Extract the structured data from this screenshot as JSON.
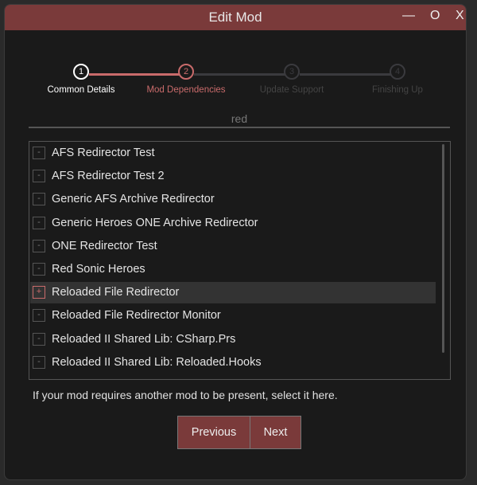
{
  "window": {
    "title": "Edit Mod",
    "minimize": "—",
    "maximize": "O",
    "close": "X"
  },
  "stepper": [
    {
      "num": "1",
      "label": "Common Details",
      "state": "done"
    },
    {
      "num": "2",
      "label": "Mod Dependencies",
      "state": "active"
    },
    {
      "num": "3",
      "label": "Update Support",
      "state": "pending"
    },
    {
      "num": "4",
      "label": "Finishing Up",
      "state": "pending"
    }
  ],
  "search": {
    "value": "red"
  },
  "list": [
    {
      "label": "AFS Redirector Test",
      "checked": false,
      "mark": "-"
    },
    {
      "label": "AFS Redirector Test 2",
      "checked": false,
      "mark": "-"
    },
    {
      "label": "Generic AFS Archive Redirector",
      "checked": false,
      "mark": "-"
    },
    {
      "label": "Generic Heroes ONE Archive Redirector",
      "checked": false,
      "mark": "-"
    },
    {
      "label": "ONE Redirector Test",
      "checked": false,
      "mark": "-"
    },
    {
      "label": "Red Sonic Heroes",
      "checked": false,
      "mark": "-"
    },
    {
      "label": "Reloaded File Redirector",
      "checked": true,
      "mark": "+"
    },
    {
      "label": "Reloaded File Redirector Monitor",
      "checked": false,
      "mark": "-"
    },
    {
      "label": "Reloaded II Shared Lib: CSharp.Prs",
      "checked": false,
      "mark": "-"
    },
    {
      "label": "Reloaded II Shared Lib: Reloaded.Hooks",
      "checked": false,
      "mark": "-"
    }
  ],
  "help": "If your mod requires another mod to be present, select it here.",
  "buttons": {
    "previous": "Previous",
    "next": "Next"
  },
  "colors": {
    "accent": "#7a3a3a",
    "active": "#c96b6b"
  }
}
